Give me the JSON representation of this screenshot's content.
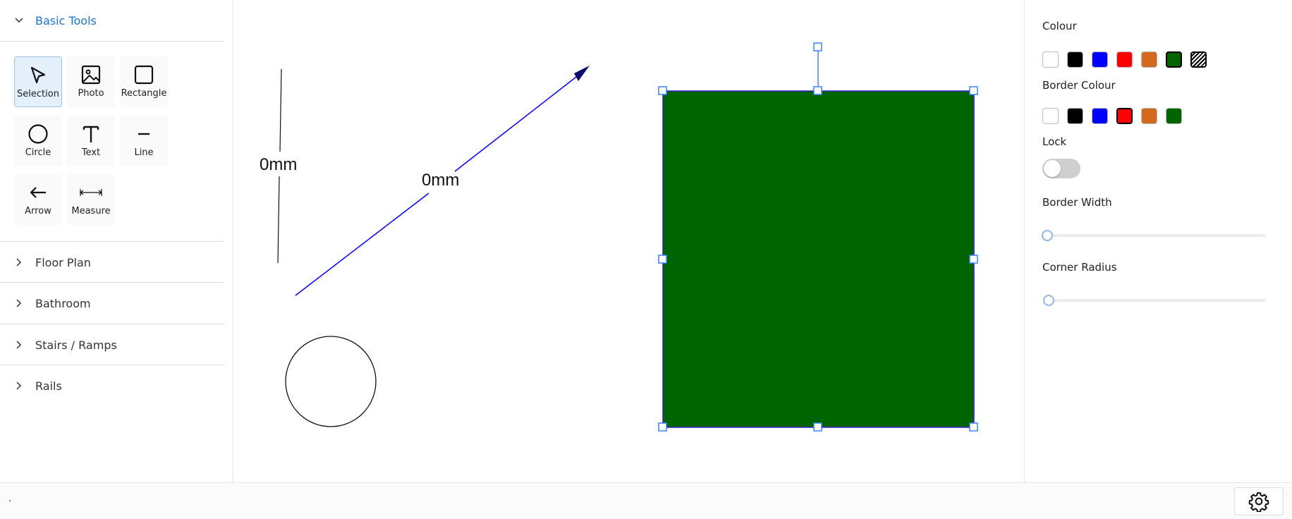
{
  "sidebar": {
    "basic_tools": {
      "title": "Basic Tools",
      "tools": [
        {
          "label": "Selection",
          "icon": "cursor-icon",
          "selected": true
        },
        {
          "label": "Photo",
          "icon": "image-icon"
        },
        {
          "label": "Rectangle",
          "icon": "rectangle-icon"
        },
        {
          "label": "Circle",
          "icon": "circle-icon"
        },
        {
          "label": "Text",
          "icon": "text-icon"
        },
        {
          "label": "Line",
          "icon": "line-icon"
        },
        {
          "label": "Arrow",
          "icon": "arrow-left-icon"
        },
        {
          "label": "Measure",
          "icon": "measure-icon"
        }
      ]
    },
    "sections": [
      {
        "label": "Floor Plan"
      },
      {
        "label": "Bathroom"
      },
      {
        "label": "Stairs / Ramps"
      },
      {
        "label": "Rails"
      }
    ]
  },
  "canvas": {
    "measure_labels": [
      "0mm",
      "0mm"
    ],
    "rectangle_fill": "#006400",
    "rectangle_border": "#3b1fd1",
    "arrow_color": "#0000ff"
  },
  "properties": {
    "colour_label": "Colour",
    "colour_swatches": [
      "#ffffff",
      "#000000",
      "#0000ff",
      "#ff0000",
      "#d2691e",
      "#006400",
      "pattern"
    ],
    "colour_selected": "#006400",
    "border_colour_label": "Border Colour",
    "border_swatches": [
      "#ffffff",
      "#000000",
      "#0000ff",
      "#ff0000",
      "#d2691e",
      "#006400"
    ],
    "border_selected": "#ff0000",
    "lock_label": "Lock",
    "lock_on": false,
    "border_width_label": "Border Width",
    "border_width_value": 0,
    "corner_radius_label": "Corner Radius",
    "corner_radius_value": 0
  },
  "footer": {
    "status": ".",
    "settings_icon": "gear-icon"
  }
}
